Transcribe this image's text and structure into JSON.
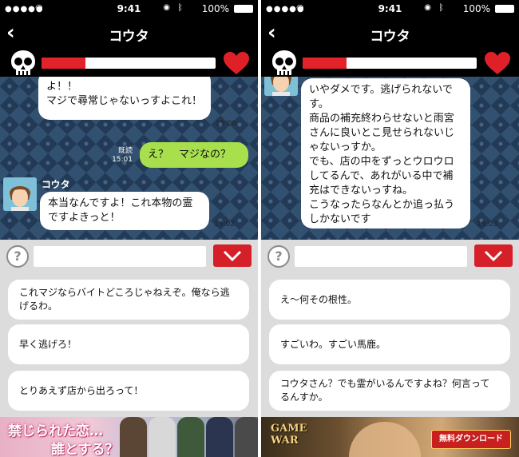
{
  "status": {
    "time": "9:41",
    "battery": "100%"
  },
  "nav": {
    "title": "コウタ",
    "back_icon": "‹"
  },
  "stats": {
    "health_fraction": 0.25,
    "health_color": "#e3232a",
    "heart_color": "#e02028"
  },
  "left": {
    "messages": {
      "m1_text": "よ！！\nマジで尋常じゃないっすよこれ！",
      "m1_time": "15:00",
      "m2_read": "既読",
      "m2_time": "15:01",
      "m2_text": "え？　マジなの？",
      "sender": "コウタ",
      "m3_text": "本当なんですよ！これ本物の霊ですよきっと！",
      "m3_time": "15:02"
    },
    "choices": [
      "これマジならバイトどころじゃねえぞ。俺なら逃げるわ。",
      "早く逃げろ！",
      "とりあえず店から出ろって！"
    ],
    "banner": {
      "line1": "禁じられた恋…",
      "line2": "誰とする？"
    }
  },
  "right": {
    "messages": {
      "m1_text": "いやダメです。逃げられないです。\n商品の補充終わらせないと雨宮さんに良いとこ見せられないじゃないっすか。\nでも、店の中をずっとウロウロしてるんで、あれがいる中で補充はできないっすね。\nこうなったらなんとか追っ払うしかないです",
      "m1_time": "15:03"
    },
    "choices": [
      "え〜何その根性。",
      "すごいわ。すごい馬鹿。",
      "コウタさん？でも霊がいるんですよね？何言ってるんすか。"
    ],
    "banner": {
      "logo_line1": "GAME",
      "logo_line2": "WAR",
      "download_label": "無料ダウンロード"
    }
  }
}
